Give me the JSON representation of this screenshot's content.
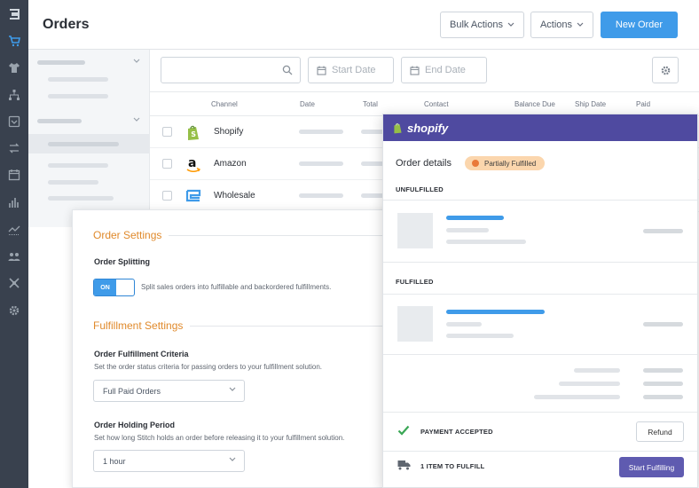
{
  "rail": {
    "icons": [
      "stitch-logo-icon",
      "cart-icon",
      "tshirt-icon",
      "hierarchy-icon",
      "inbox-icon",
      "transfer-icon",
      "calendar-icon",
      "bar-chart-icon",
      "trend-icon",
      "users-icon",
      "puzzle-icon",
      "settings-icon"
    ],
    "active": "cart-icon"
  },
  "header": {
    "title": "Orders",
    "bulk_actions": "Bulk Actions",
    "actions": "Actions",
    "new_order": "New Order"
  },
  "search": {
    "placeholder": "",
    "start_date": "Start Date",
    "end_date": "End Date"
  },
  "table": {
    "columns": [
      "Channel",
      "Date",
      "Total",
      "Contact",
      "Balance Due",
      "Ship Date",
      "Paid"
    ],
    "rows": [
      {
        "channel": "Shopify",
        "logo": "shopify-logo-icon"
      },
      {
        "channel": "Amazon",
        "logo": "amazon-logo-icon"
      },
      {
        "channel": "Wholesale",
        "logo": "wholesale-logo-icon"
      }
    ]
  },
  "settings": {
    "order_settings_title": "Order Settings",
    "order_splitting_label": "Order Splitting",
    "toggle_state": "ON",
    "toggle_description": "Split sales orders into fulfillable and backordered fulfillments.",
    "fulfillment_settings_title": "Fulfillment Settings",
    "criteria_label": "Order Fulfillment Criteria",
    "criteria_help": "Set the order status criteria for passing orders to your fulfillment solution.",
    "criteria_value": "Full Paid Orders",
    "holding_label": "Order Holding Period",
    "holding_help": "Set how long Stitch holds an order before releasing it to your fulfillment solution.",
    "holding_value": "1 hour"
  },
  "shopify": {
    "brand": "shopify",
    "order_details": "Order details",
    "status_badge": "Partially Fulfilled",
    "unfulfilled": "UNFULFILLED",
    "fulfilled": "FULFILLED",
    "payment_accepted": "PAYMENT ACCEPTED",
    "refund": "Refund",
    "items_to_fulfill": "1 ITEM TO FULFILL",
    "start_fulfilling": "Start Fulfilling"
  },
  "colors": {
    "rail": "#39414e",
    "primary": "#3f9be9",
    "section_title": "#e08a2c",
    "shopify_header": "#4f4aa0",
    "fulfill_button": "#5f5bb0",
    "badge_bg": "#fbd6ad",
    "badge_dot": "#e9793a",
    "check": "#3aa755"
  }
}
